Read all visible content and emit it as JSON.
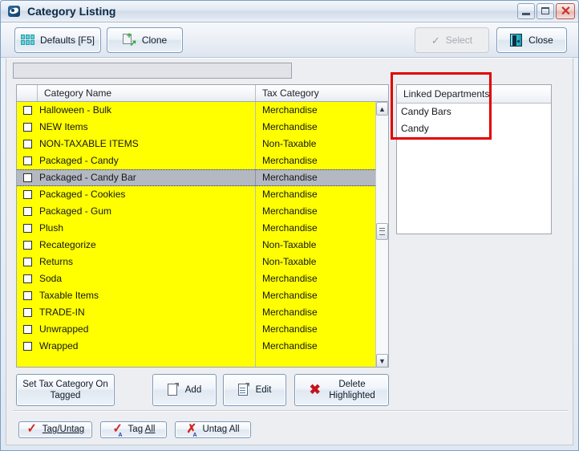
{
  "window": {
    "title": "Category Listing",
    "icon": "app-disc-icon",
    "controls": {
      "minimize": "–",
      "maximize": "□",
      "close": "✕"
    }
  },
  "toolbar": {
    "defaults_label": "Defaults [F5]",
    "clone_label": "Clone",
    "select_label": "Select",
    "select_check": "✓",
    "select_disabled": true,
    "close_label": "Close"
  },
  "filter": {
    "value": "",
    "placeholder": ""
  },
  "grid": {
    "columns": [
      "",
      "Category Name",
      "Tax Category"
    ],
    "selected_index": 4,
    "rows": [
      {
        "tagged": false,
        "name": "Halloween - Bulk",
        "tax": "Merchandise"
      },
      {
        "tagged": false,
        "name": "NEW Items",
        "tax": "Merchandise"
      },
      {
        "tagged": false,
        "name": "NON-TAXABLE ITEMS",
        "tax": "Non-Taxable"
      },
      {
        "tagged": false,
        "name": "Packaged - Candy",
        "tax": "Merchandise"
      },
      {
        "tagged": false,
        "name": "Packaged - Candy Bar",
        "tax": "Merchandise"
      },
      {
        "tagged": false,
        "name": "Packaged - Cookies",
        "tax": "Merchandise"
      },
      {
        "tagged": false,
        "name": "Packaged - Gum",
        "tax": "Merchandise"
      },
      {
        "tagged": false,
        "name": "Plush",
        "tax": "Merchandise"
      },
      {
        "tagged": false,
        "name": "Recategorize",
        "tax": "Non-Taxable"
      },
      {
        "tagged": false,
        "name": "Returns",
        "tax": "Non-Taxable"
      },
      {
        "tagged": false,
        "name": "Soda",
        "tax": "Merchandise"
      },
      {
        "tagged": false,
        "name": "Taxable Items",
        "tax": "Merchandise"
      },
      {
        "tagged": false,
        "name": "TRADE-IN",
        "tax": "Merchandise"
      },
      {
        "tagged": false,
        "name": "Unwrapped",
        "tax": "Merchandise"
      },
      {
        "tagged": false,
        "name": "Wrapped",
        "tax": "Merchandise"
      }
    ],
    "scrollbar": {
      "up_arrow": "▲",
      "down_arrow": "▼"
    },
    "row_background": "#ffff00",
    "selected_background": "#b4b8c0"
  },
  "linked_departments": {
    "header": "Linked Departments",
    "items": [
      "Candy Bars",
      "Candy"
    ]
  },
  "annotation": {
    "color": "#e20000"
  },
  "actions": {
    "set_tax_line1": "Set Tax Category On",
    "set_tax_line2_pre": "Ta",
    "set_tax_line2_accel": "g",
    "set_tax_line2_post": "ged",
    "add_label": "Add",
    "edit_label": "Edit",
    "delete_line1": "Delete",
    "delete_line2": "Highlighted",
    "delete_icon": "✖"
  },
  "tagging": {
    "tag_untag_accel": "T",
    "tag_untag_rest": "ag/Untag",
    "tag_all_pre": "Tag ",
    "tag_all_accel": "A",
    "tag_all_post": "ll",
    "untag_all_pre": "Unta",
    "untag_all_accel": "g",
    "untag_all_post": " All"
  }
}
